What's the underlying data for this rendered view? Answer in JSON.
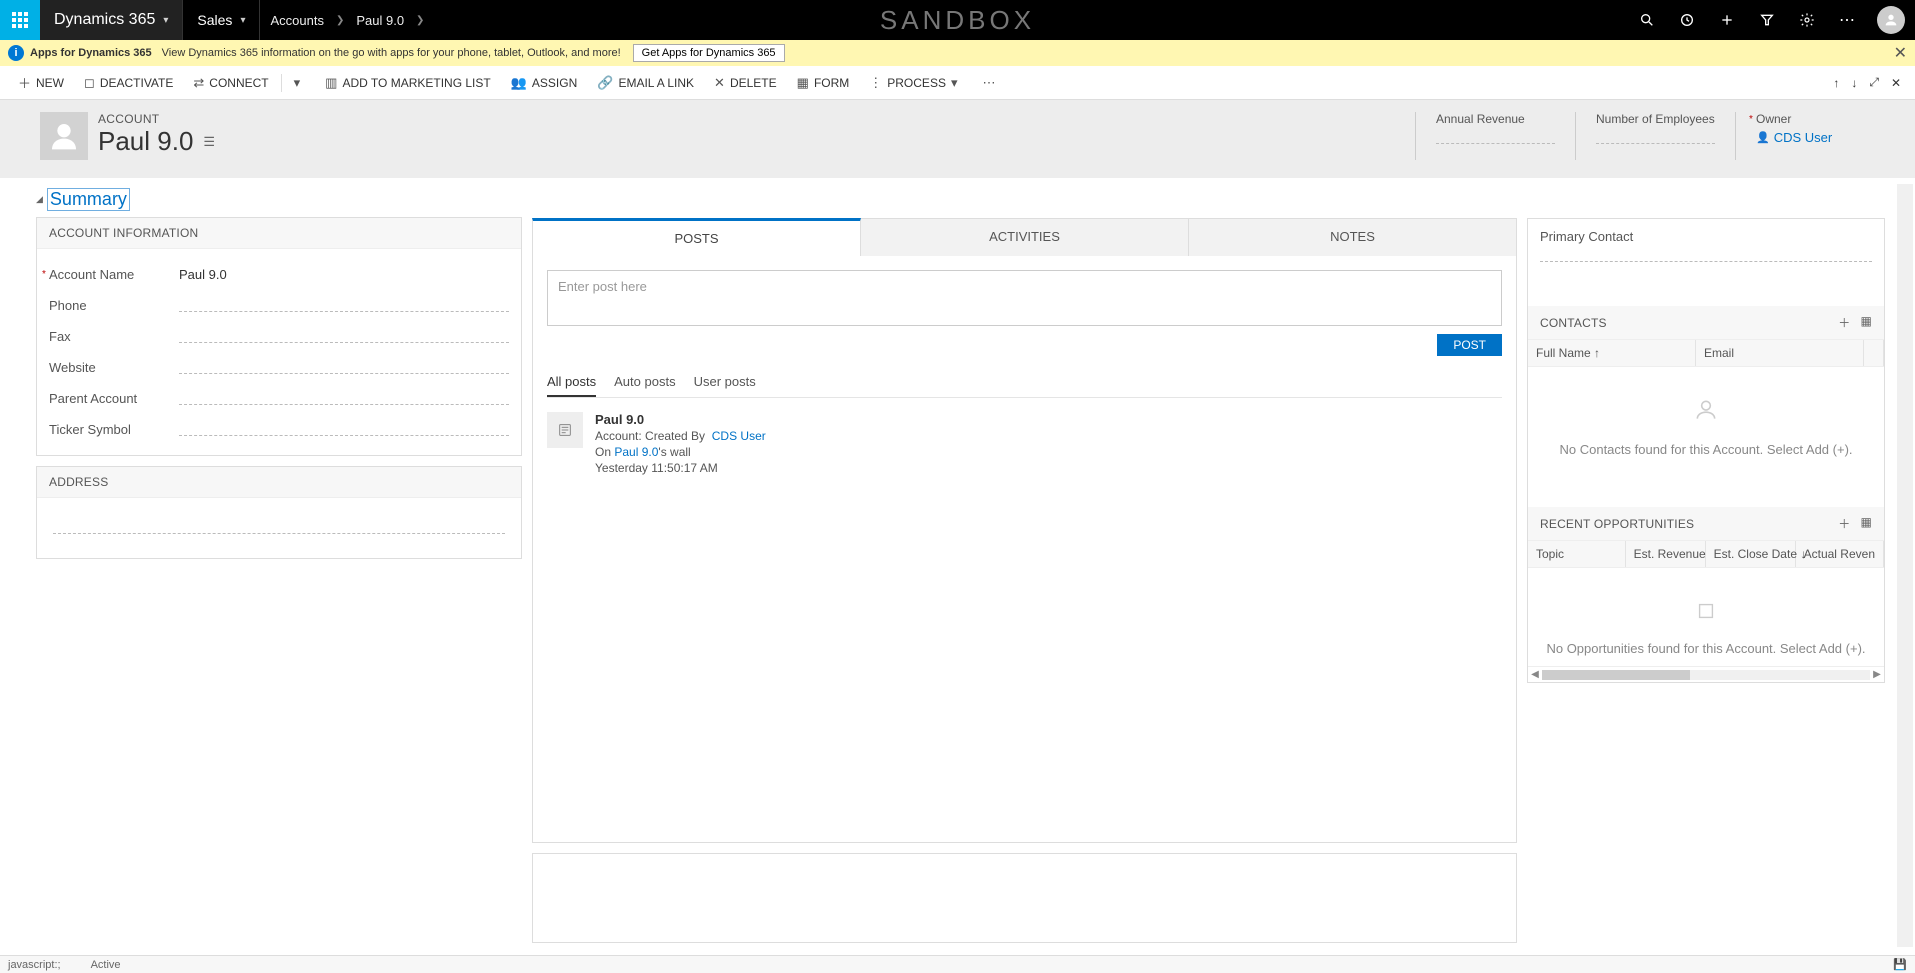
{
  "topnav": {
    "brand": "Dynamics 365",
    "area": "Sales",
    "breadcrumbs": [
      "Accounts",
      "Paul 9.0"
    ],
    "sandbox": "SANDBOX"
  },
  "infobar": {
    "title": "Apps for Dynamics 365",
    "text": "View Dynamics 365 information on the go with apps for your phone, tablet, Outlook, and more!",
    "button": "Get Apps for Dynamics 365"
  },
  "commands": {
    "new": "NEW",
    "deactivate": "DEACTIVATE",
    "connect": "CONNECT",
    "add_marketing": "ADD TO MARKETING LIST",
    "assign": "ASSIGN",
    "email_link": "EMAIL A LINK",
    "delete": "DELETE",
    "form": "FORM",
    "process": "PROCESS"
  },
  "record": {
    "entity": "ACCOUNT",
    "name": "Paul 9.0",
    "annual_revenue_label": "Annual Revenue",
    "num_employees_label": "Number of Employees",
    "owner_label": "Owner",
    "owner_value": "CDS User"
  },
  "summary": {
    "label": "Summary"
  },
  "account_info": {
    "header": "ACCOUNT INFORMATION",
    "fields": {
      "account_name_label": "Account Name",
      "account_name_value": "Paul 9.0",
      "phone_label": "Phone",
      "fax_label": "Fax",
      "website_label": "Website",
      "parent_account_label": "Parent Account",
      "ticker_label": "Ticker Symbol"
    }
  },
  "address": {
    "header": "ADDRESS"
  },
  "tabs": {
    "posts": "POSTS",
    "activities": "ACTIVITIES",
    "notes": "NOTES",
    "post_placeholder": "Enter post here",
    "post_button": "POST",
    "filters": {
      "all": "All posts",
      "auto": "Auto posts",
      "user": "User posts"
    },
    "item": {
      "title": "Paul 9.0",
      "created_prefix": "Account: Created By",
      "created_by": "CDS User",
      "on_prefix": "On",
      "on_link": "Paul 9.0",
      "on_suffix": "'s wall",
      "time": "Yesterday 11:50:17 AM"
    }
  },
  "right": {
    "primary_contact_label": "Primary Contact",
    "contacts": {
      "header": "CONTACTS",
      "col_name": "Full Name ↑",
      "col_email": "Email",
      "empty": "No Contacts found for this Account. Select Add (+)."
    },
    "opps": {
      "header": "RECENT OPPORTUNITIES",
      "col_topic": "Topic",
      "col_rev": "Est. Revenue",
      "col_close": "Est. Close Date ↓",
      "col_actual": "Actual Reven",
      "empty": "No Opportunities found for this Account. Select Add (+)."
    }
  },
  "footer": {
    "js": "javascript:;",
    "status": "Active"
  }
}
